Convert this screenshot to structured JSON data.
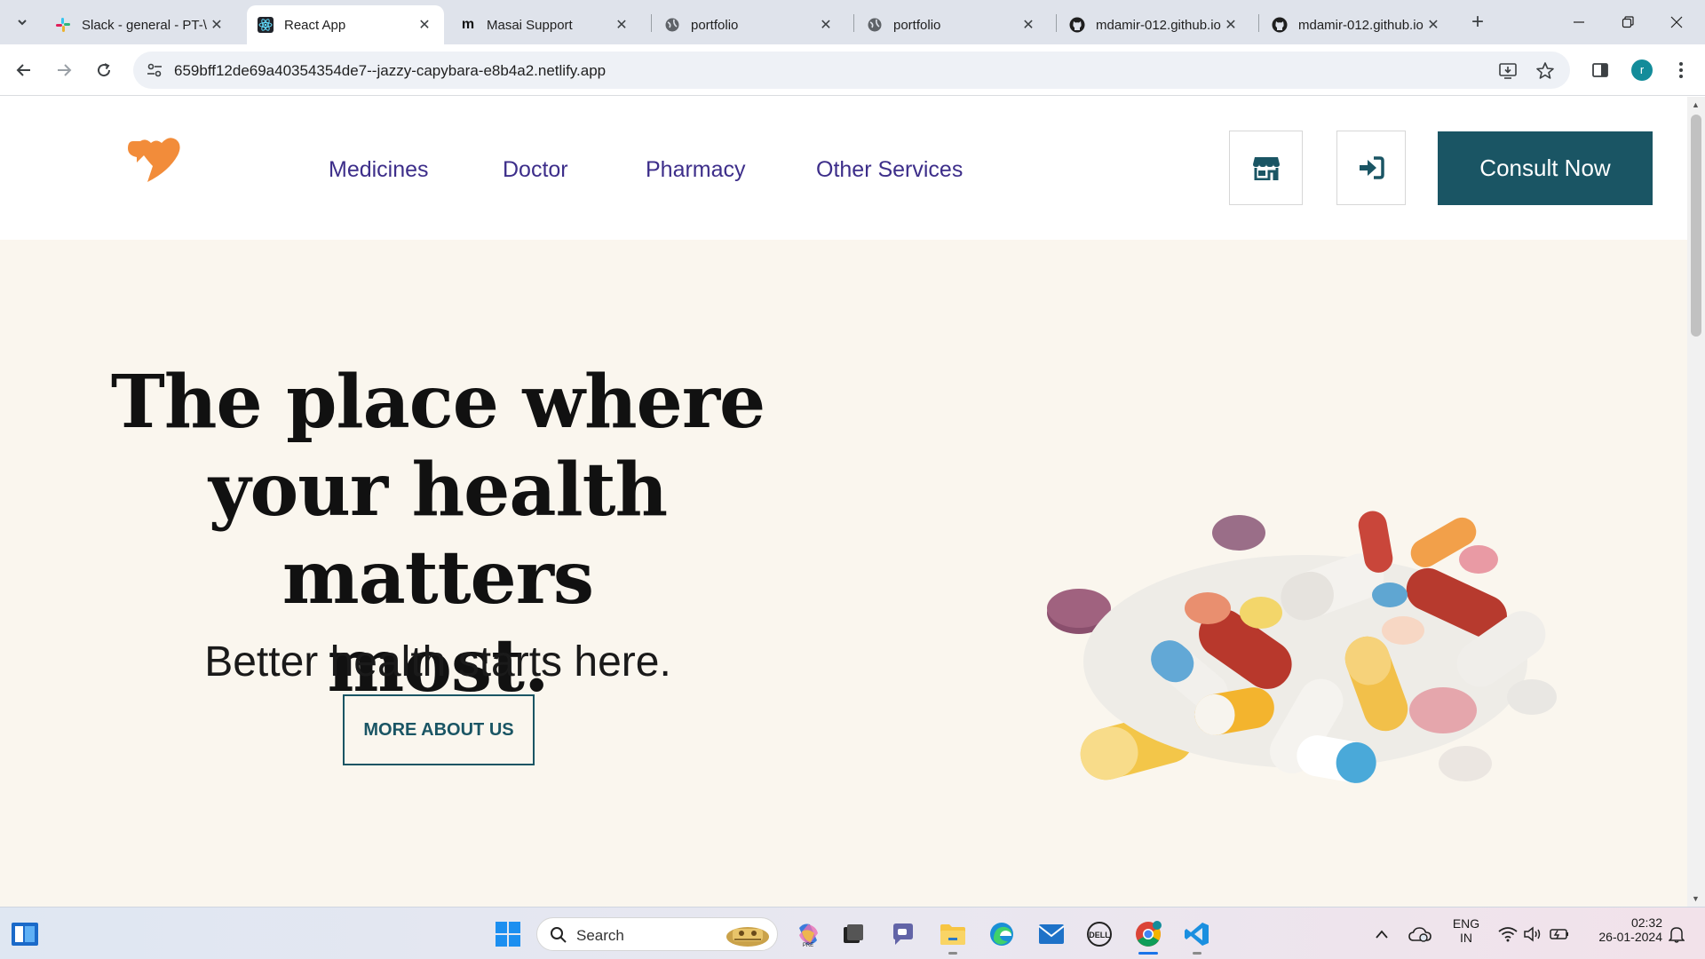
{
  "browser": {
    "tabs": [
      {
        "title": "Slack - general - PT-\\",
        "active": false
      },
      {
        "title": "React App",
        "active": true
      },
      {
        "title": "Masai Support",
        "active": false
      },
      {
        "title": "portfolio",
        "active": false
      },
      {
        "title": "portfolio",
        "active": false
      },
      {
        "title": "mdamir-012.github.io",
        "active": false
      },
      {
        "title": "mdamir-012.github.io",
        "active": false
      }
    ],
    "url": "659bff12de69a40354354de7--jazzy-capybara-e8b4a2.netlify.app",
    "profile_initial": "r"
  },
  "site": {
    "nav_links": [
      "Medicines",
      "Doctor",
      "Pharmacy",
      "Other Services"
    ],
    "consult_label": "Consult Now",
    "brand_color": "#1a5564",
    "logo_color": "#f28c3a"
  },
  "hero": {
    "title_line1": "The place where",
    "title_line2": "your health matters",
    "title_line3": "most.",
    "subtitle": "Better health starts here.",
    "button_label": "MORE ABOUT US",
    "background": "#faf6ee"
  },
  "taskbar": {
    "search_label": "Search",
    "lang_line1": "ENG",
    "lang_line2": "IN",
    "time": "02:32",
    "date": "26-01-2024"
  }
}
